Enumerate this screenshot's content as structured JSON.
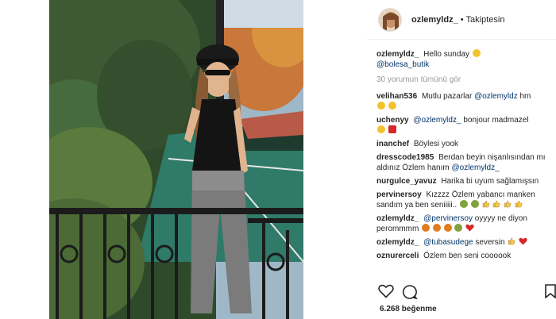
{
  "header": {
    "username": "ozlemyldz_",
    "separator": "•",
    "follow_status": "Takiptesin"
  },
  "caption": {
    "username": "ozlemyldz_",
    "text": "Hello sunday",
    "mention": "@bolesa_butik"
  },
  "view_all_comments": "30 yorumun tümünü gör",
  "comments": [
    {
      "user": "velihan536",
      "pre": "Mutlu pazarlar",
      "mention": "@ozlemyldz",
      "post": "hm"
    },
    {
      "user": "uchenyy",
      "pre": "",
      "mention": "@ozlemyldz_",
      "post": "bonjour madmazel"
    },
    {
      "user": "inanchef",
      "pre": "Böylesi yook",
      "mention": "",
      "post": ""
    },
    {
      "user": "dresscode1985",
      "pre": "Berdan beyin nişanlısından mı aldınız Özlem hanım",
      "mention": "@ozlemyldz_",
      "post": ""
    },
    {
      "user": "nurgulce_yavuz",
      "pre": "Harika bi uyum sağlamışsın",
      "mention": "",
      "post": ""
    },
    {
      "user": "pervinersoy",
      "pre": "Kızzzz Özlem yabancı manken sandım ya ben seniiiii..",
      "mention": "",
      "post": ""
    },
    {
      "user": "ozlemyldz_",
      "pre": "",
      "mention": "@pervinersoy",
      "post": "oyyyy ne diyon perommmm"
    },
    {
      "user": "ozlemyldz_",
      "pre": "",
      "mention": "@tubasudege",
      "post": "seversin"
    },
    {
      "user": "oznurerceli",
      "pre": "Özlem ben seni coooook",
      "mention": "",
      "post": ""
    }
  ],
  "likes": "6.268 beğenme",
  "icons": {
    "like": "heart-icon",
    "comment": "comment-icon",
    "save": "bookmark-icon"
  },
  "colors": {
    "text": "#262626",
    "mention": "#003569",
    "muted": "#999999"
  }
}
